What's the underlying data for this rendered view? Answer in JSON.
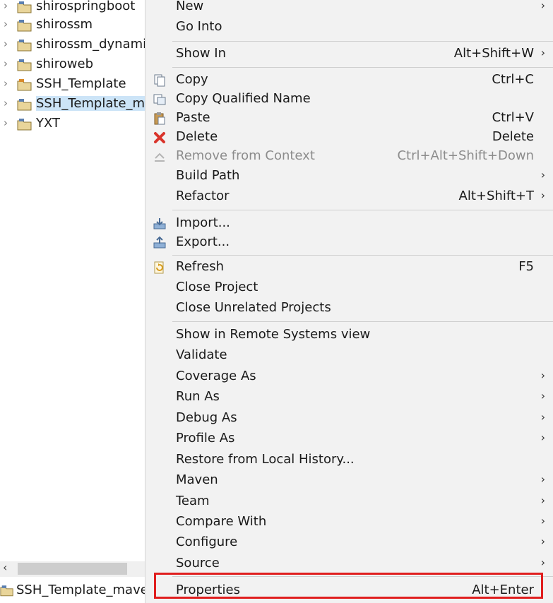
{
  "tree": {
    "items": [
      {
        "label": "shirospringboot"
      },
      {
        "label": "shirossm"
      },
      {
        "label": "shirossm_dynami"
      },
      {
        "label": "shiroweb"
      },
      {
        "label": "SSH_Template"
      },
      {
        "label": "SSH_Template_m"
      },
      {
        "label": "YXT"
      }
    ]
  },
  "status": {
    "label": "SSH_Template_mave"
  },
  "menu": {
    "items": [
      {
        "label": "New",
        "shortcut": ""
      },
      {
        "label": "Go Into",
        "shortcut": ""
      },
      {
        "label": "Show In",
        "shortcut": "Alt+Shift+W"
      },
      {
        "label": "Copy",
        "shortcut": "Ctrl+C"
      },
      {
        "label": "Copy Qualified Name",
        "shortcut": ""
      },
      {
        "label": "Paste",
        "shortcut": "Ctrl+V"
      },
      {
        "label": "Delete",
        "shortcut": "Delete"
      },
      {
        "label": "Remove from Context",
        "shortcut": "Ctrl+Alt+Shift+Down"
      },
      {
        "label": "Build Path",
        "shortcut": ""
      },
      {
        "label": "Refactor",
        "shortcut": "Alt+Shift+T"
      },
      {
        "label": "Import...",
        "shortcut": ""
      },
      {
        "label": "Export...",
        "shortcut": ""
      },
      {
        "label": "Refresh",
        "shortcut": "F5"
      },
      {
        "label": "Close Project",
        "shortcut": ""
      },
      {
        "label": "Close Unrelated Projects",
        "shortcut": ""
      },
      {
        "label": "Show in Remote Systems view",
        "shortcut": ""
      },
      {
        "label": "Validate",
        "shortcut": ""
      },
      {
        "label": "Coverage As",
        "shortcut": ""
      },
      {
        "label": "Run As",
        "shortcut": ""
      },
      {
        "label": "Debug As",
        "shortcut": ""
      },
      {
        "label": "Profile As",
        "shortcut": ""
      },
      {
        "label": "Restore from Local History...",
        "shortcut": ""
      },
      {
        "label": "Maven",
        "shortcut": ""
      },
      {
        "label": "Team",
        "shortcut": ""
      },
      {
        "label": "Compare With",
        "shortcut": ""
      },
      {
        "label": "Configure",
        "shortcut": ""
      },
      {
        "label": "Source",
        "shortcut": ""
      },
      {
        "label": "Properties",
        "shortcut": "Alt+Enter"
      }
    ]
  },
  "colors": {
    "highlight_border": "#e01e1e",
    "selection": "#cce4f7",
    "menu_bg": "#f2f2f2"
  }
}
